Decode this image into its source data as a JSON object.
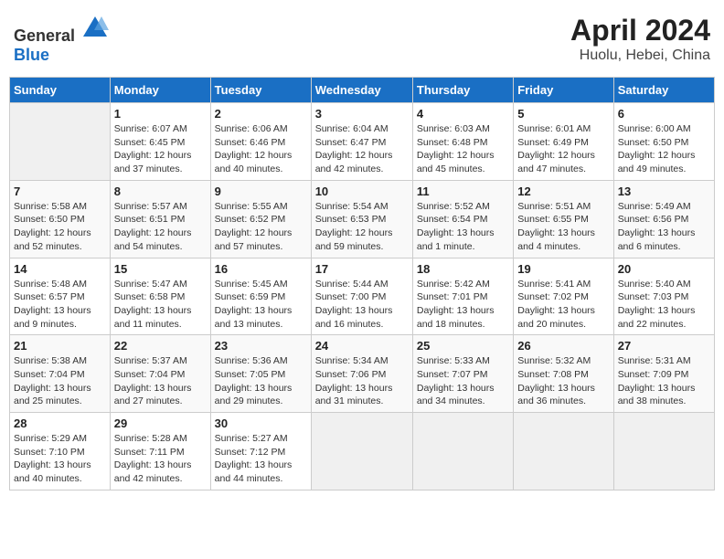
{
  "header": {
    "logo_general": "General",
    "logo_blue": "Blue",
    "month": "April 2024",
    "location": "Huolu, Hebei, China"
  },
  "days_of_week": [
    "Sunday",
    "Monday",
    "Tuesday",
    "Wednesday",
    "Thursday",
    "Friday",
    "Saturday"
  ],
  "weeks": [
    [
      {
        "day": "",
        "info": ""
      },
      {
        "day": "1",
        "info": "Sunrise: 6:07 AM\nSunset: 6:45 PM\nDaylight: 12 hours\nand 37 minutes."
      },
      {
        "day": "2",
        "info": "Sunrise: 6:06 AM\nSunset: 6:46 PM\nDaylight: 12 hours\nand 40 minutes."
      },
      {
        "day": "3",
        "info": "Sunrise: 6:04 AM\nSunset: 6:47 PM\nDaylight: 12 hours\nand 42 minutes."
      },
      {
        "day": "4",
        "info": "Sunrise: 6:03 AM\nSunset: 6:48 PM\nDaylight: 12 hours\nand 45 minutes."
      },
      {
        "day": "5",
        "info": "Sunrise: 6:01 AM\nSunset: 6:49 PM\nDaylight: 12 hours\nand 47 minutes."
      },
      {
        "day": "6",
        "info": "Sunrise: 6:00 AM\nSunset: 6:50 PM\nDaylight: 12 hours\nand 49 minutes."
      }
    ],
    [
      {
        "day": "7",
        "info": "Sunrise: 5:58 AM\nSunset: 6:50 PM\nDaylight: 12 hours\nand 52 minutes."
      },
      {
        "day": "8",
        "info": "Sunrise: 5:57 AM\nSunset: 6:51 PM\nDaylight: 12 hours\nand 54 minutes."
      },
      {
        "day": "9",
        "info": "Sunrise: 5:55 AM\nSunset: 6:52 PM\nDaylight: 12 hours\nand 57 minutes."
      },
      {
        "day": "10",
        "info": "Sunrise: 5:54 AM\nSunset: 6:53 PM\nDaylight: 12 hours\nand 59 minutes."
      },
      {
        "day": "11",
        "info": "Sunrise: 5:52 AM\nSunset: 6:54 PM\nDaylight: 13 hours\nand 1 minute."
      },
      {
        "day": "12",
        "info": "Sunrise: 5:51 AM\nSunset: 6:55 PM\nDaylight: 13 hours\nand 4 minutes."
      },
      {
        "day": "13",
        "info": "Sunrise: 5:49 AM\nSunset: 6:56 PM\nDaylight: 13 hours\nand 6 minutes."
      }
    ],
    [
      {
        "day": "14",
        "info": "Sunrise: 5:48 AM\nSunset: 6:57 PM\nDaylight: 13 hours\nand 9 minutes."
      },
      {
        "day": "15",
        "info": "Sunrise: 5:47 AM\nSunset: 6:58 PM\nDaylight: 13 hours\nand 11 minutes."
      },
      {
        "day": "16",
        "info": "Sunrise: 5:45 AM\nSunset: 6:59 PM\nDaylight: 13 hours\nand 13 minutes."
      },
      {
        "day": "17",
        "info": "Sunrise: 5:44 AM\nSunset: 7:00 PM\nDaylight: 13 hours\nand 16 minutes."
      },
      {
        "day": "18",
        "info": "Sunrise: 5:42 AM\nSunset: 7:01 PM\nDaylight: 13 hours\nand 18 minutes."
      },
      {
        "day": "19",
        "info": "Sunrise: 5:41 AM\nSunset: 7:02 PM\nDaylight: 13 hours\nand 20 minutes."
      },
      {
        "day": "20",
        "info": "Sunrise: 5:40 AM\nSunset: 7:03 PM\nDaylight: 13 hours\nand 22 minutes."
      }
    ],
    [
      {
        "day": "21",
        "info": "Sunrise: 5:38 AM\nSunset: 7:04 PM\nDaylight: 13 hours\nand 25 minutes."
      },
      {
        "day": "22",
        "info": "Sunrise: 5:37 AM\nSunset: 7:04 PM\nDaylight: 13 hours\nand 27 minutes."
      },
      {
        "day": "23",
        "info": "Sunrise: 5:36 AM\nSunset: 7:05 PM\nDaylight: 13 hours\nand 29 minutes."
      },
      {
        "day": "24",
        "info": "Sunrise: 5:34 AM\nSunset: 7:06 PM\nDaylight: 13 hours\nand 31 minutes."
      },
      {
        "day": "25",
        "info": "Sunrise: 5:33 AM\nSunset: 7:07 PM\nDaylight: 13 hours\nand 34 minutes."
      },
      {
        "day": "26",
        "info": "Sunrise: 5:32 AM\nSunset: 7:08 PM\nDaylight: 13 hours\nand 36 minutes."
      },
      {
        "day": "27",
        "info": "Sunrise: 5:31 AM\nSunset: 7:09 PM\nDaylight: 13 hours\nand 38 minutes."
      }
    ],
    [
      {
        "day": "28",
        "info": "Sunrise: 5:29 AM\nSunset: 7:10 PM\nDaylight: 13 hours\nand 40 minutes."
      },
      {
        "day": "29",
        "info": "Sunrise: 5:28 AM\nSunset: 7:11 PM\nDaylight: 13 hours\nand 42 minutes."
      },
      {
        "day": "30",
        "info": "Sunrise: 5:27 AM\nSunset: 7:12 PM\nDaylight: 13 hours\nand 44 minutes."
      },
      {
        "day": "",
        "info": ""
      },
      {
        "day": "",
        "info": ""
      },
      {
        "day": "",
        "info": ""
      },
      {
        "day": "",
        "info": ""
      }
    ]
  ]
}
